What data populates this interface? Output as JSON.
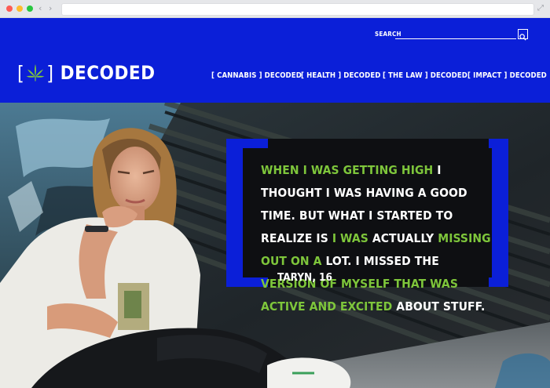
{
  "site": {
    "logo_text": "DECODED",
    "logo_open_bracket": "[",
    "logo_close_bracket": "]",
    "logo_icon": "cannabis-leaf-icon"
  },
  "search": {
    "label": "SEARCH",
    "placeholder": "",
    "value": "",
    "button_icon": "magnifier-icon"
  },
  "nav": {
    "items": [
      {
        "label": "[ CANNABIS ] DECODED"
      },
      {
        "label": "[ HEALTH ] DECODED"
      },
      {
        "label": "[ THE LAW ] DECODED"
      },
      {
        "label": "[ IMPACT ] DECODED"
      }
    ]
  },
  "quote": {
    "segments": [
      {
        "text": "WHEN I WAS GETTING HIGH",
        "highlight": true
      },
      {
        "text": " I THOUGHT I WAS HAVING A GOOD TIME. BUT WHAT I STARTED TO REALIZE IS ",
        "highlight": false
      },
      {
        "text": "I WAS",
        "highlight": true
      },
      {
        "text": " ACTUALLY ",
        "highlight": false
      },
      {
        "text": "MISSING OUT ON A",
        "highlight": true
      },
      {
        "text": " LOT. I MISSED THE ",
        "highlight": false
      },
      {
        "text": " VERSION OF MYSELF THAT WAS ACTIVE AND EXCITED",
        "highlight": true
      },
      {
        "text": " ABOUT STUFF.",
        "highlight": false
      }
    ],
    "attribution": "TARYN, 16"
  },
  "colors": {
    "brand_blue": "#0b1fd8",
    "highlight_green": "#7ec63b",
    "quote_background": "#0e0f12"
  }
}
